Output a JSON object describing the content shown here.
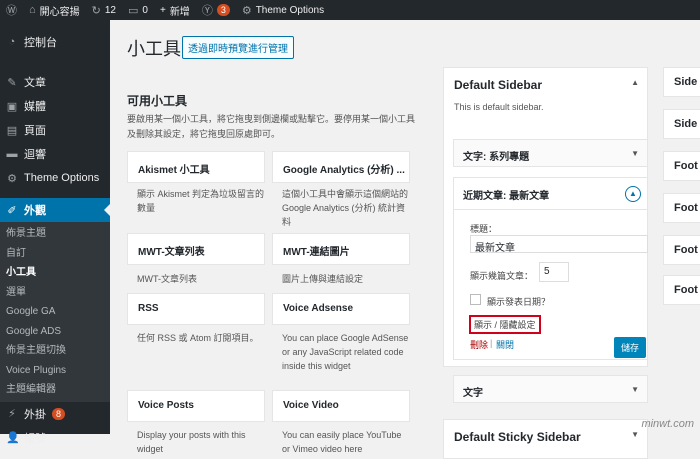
{
  "adminbar": {
    "site": "開心容揚",
    "updates": "12",
    "comments": "0",
    "new": "新增",
    "yoast_count": "3",
    "theme_options": "Theme Options"
  },
  "sidebar": {
    "items": [
      {
        "label": "控制台",
        "icon": "dashboard-icon"
      },
      {
        "label": "文章",
        "icon": "pin-icon"
      },
      {
        "label": "媒體",
        "icon": "media-icon"
      },
      {
        "label": "頁面",
        "icon": "page-icon"
      },
      {
        "label": "迴響",
        "icon": "comment-icon"
      },
      {
        "label": "Theme Options",
        "icon": "gear-icon"
      },
      {
        "label": "外觀",
        "icon": "brush-icon"
      }
    ],
    "submenu": [
      "佈景主題",
      "自訂",
      "小工具",
      "選單",
      "Google GA",
      "Google ADS",
      "佈景主題切換",
      "Voice Plugins",
      "主題編輯器"
    ],
    "plugins_label": "外掛",
    "plugins_count": "8",
    "users_label": "帳號"
  },
  "page": {
    "title": "小工具",
    "preview_button": "透過即時預覽進行管理",
    "available_title": "可用小工具",
    "available_desc": "要啟用某一個小工具，將它拖曳到側邊欄或點擊它。要停用某一個小工具及刪除其設定，將它拖曳回原處即可。"
  },
  "widgets": [
    {
      "name": "Akismet 小工具",
      "desc": "顯示 Akismet 判定為垃圾留言的數量"
    },
    {
      "name": "Google Analytics (分析) ...",
      "desc": "這個小工具中會顯示這個網站的 Google Analytics (分析) 統計資料"
    },
    {
      "name": "MWT-文章列表",
      "desc": "MWT-文章列表"
    },
    {
      "name": "MWT-連結圖片",
      "desc": "圖片上傳與連結設定"
    },
    {
      "name": "RSS",
      "desc": "任何 RSS 或 Atom 訂閱項目。"
    },
    {
      "name": "Voice Adsense",
      "desc": "You can place Google AdSense or any JavaScript related code inside this widget"
    },
    {
      "name": "Voice Posts",
      "desc": "Display your posts with this widget"
    },
    {
      "name": "Voice Video",
      "desc": "You can easily place YouTube or Vimeo video here"
    }
  ],
  "default_sidebar": {
    "title": "Default Sidebar",
    "desc": "This is default sidebar.",
    "item1": "文字: 系列專題",
    "item2": "近期文章: 最新文章",
    "title_label": "標題：",
    "title_value": "最新文章",
    "count_label": "顯示幾篇文章：",
    "count_value": "5",
    "date_label": "顯示發表日期？",
    "toggle_button": "顯示 / 隱藏設定",
    "delete_link": "刪除",
    "sep": "|",
    "close_link": "關閉",
    "save_button": "儲存",
    "item3": "文字"
  },
  "sticky_sidebar": {
    "title": "Default Sticky Sidebar"
  },
  "right_cards": [
    "Side",
    "Side",
    "Foot",
    "Foot",
    "Foot",
    "Foot"
  ],
  "watermark": "minwt.com"
}
